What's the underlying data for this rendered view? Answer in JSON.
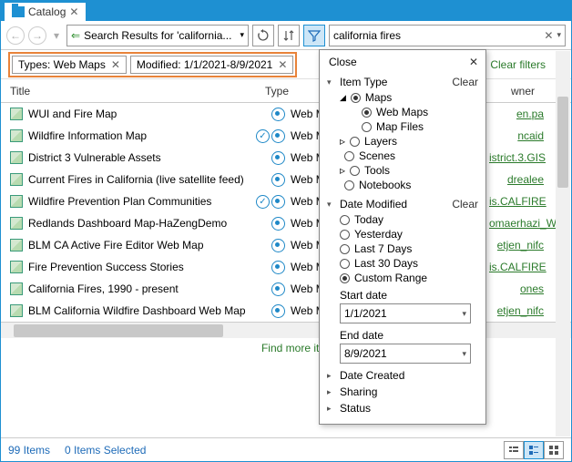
{
  "window": {
    "title": "Catalog"
  },
  "toolbar": {
    "address": "Search Results for 'california...",
    "search_value": "california fires"
  },
  "chips": {
    "types": "Types: Web Maps",
    "modified": "Modified: 1/1/2021-8/9/2021",
    "clear_filters": "Clear filters"
  },
  "columns": {
    "title": "Title",
    "type": "Type",
    "owner": "wner"
  },
  "rows": [
    {
      "title": "WUI and Fire Map",
      "check": false,
      "type": "Web M",
      "owner": "en.pa"
    },
    {
      "title": "Wildfire Information Map",
      "check": true,
      "type": "Web M",
      "owner": "ncaid"
    },
    {
      "title": "District 3 Vulnerable Assets",
      "check": false,
      "type": "Web M",
      "owner": "istrict.3.GIS"
    },
    {
      "title": "Current Fires in California (live satellite feed)",
      "check": false,
      "type": "Web M",
      "owner": "drealee"
    },
    {
      "title": "Wildfire Prevention Plan Communities",
      "check": true,
      "type": "Web M",
      "owner": "is.CALFIRE"
    },
    {
      "title": "Redlands Dashboard Map-HaZengDemo",
      "check": false,
      "type": "Web M",
      "owner": "omaerhazi_W"
    },
    {
      "title": "BLM CA Active Fire Editor Web Map",
      "check": false,
      "type": "Web M",
      "owner": "etjen_nifc"
    },
    {
      "title": "Fire Prevention Success Stories",
      "check": false,
      "type": "Web M",
      "owner": "is.CALFIRE"
    },
    {
      "title": "California Fires, 1990 - present",
      "check": false,
      "type": "Web M",
      "owner": "ones"
    },
    {
      "title": "BLM California Wildfire Dashboard Web Map",
      "check": false,
      "type": "Web M",
      "owner": "etjen_nifc"
    }
  ],
  "find_more": "Find more item",
  "status": {
    "items": "99 Items",
    "selected": "0 Items Selected"
  },
  "filter": {
    "close_label": "Close",
    "item_type": {
      "label": "Item Type",
      "clear": "Clear",
      "maps": "Maps",
      "web_maps": "Web Maps",
      "map_files": "Map Files",
      "layers": "Layers",
      "scenes": "Scenes",
      "tools": "Tools",
      "notebooks": "Notebooks"
    },
    "date_modified": {
      "label": "Date Modified",
      "clear": "Clear",
      "today": "Today",
      "yesterday": "Yesterday",
      "last7": "Last 7 Days",
      "last30": "Last 30 Days",
      "custom": "Custom Range",
      "start_label": "Start date",
      "start_value": "1/1/2021",
      "end_label": "End date",
      "end_value": "8/9/2021"
    },
    "date_created": "Date Created",
    "sharing": "Sharing",
    "status": "Status"
  }
}
